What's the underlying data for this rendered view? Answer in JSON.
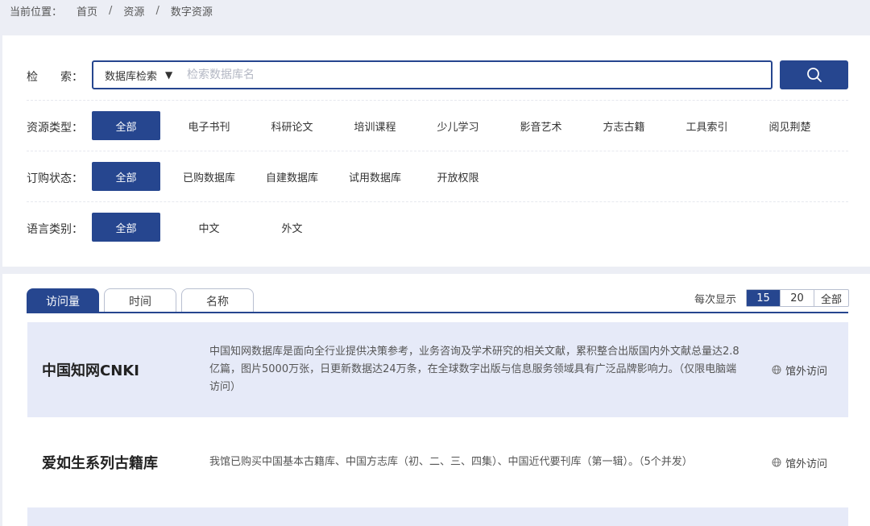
{
  "breadcrumb": {
    "prefix": "当前位置：",
    "items": [
      "首页",
      "资源",
      "数字资源"
    ],
    "sep": "/"
  },
  "search": {
    "label_a": "检",
    "label_b": "索：",
    "scope": "数据库检索",
    "placeholder": "检索数据库名",
    "value": ""
  },
  "filters": {
    "resource_type": {
      "label": "资源类型：",
      "options": [
        "全部",
        "电子书刊",
        "科研论文",
        "培训课程",
        "少儿学习",
        "影音艺术",
        "方志古籍",
        "工具索引",
        "阅见荆楚"
      ]
    },
    "order_status": {
      "label": "订购状态：",
      "options": [
        "全部",
        "已购数据库",
        "自建数据库",
        "试用数据库",
        "开放权限"
      ]
    },
    "language": {
      "label": "语言类别：",
      "options": [
        "全部",
        "中文",
        "外文"
      ]
    }
  },
  "tabs": [
    "访问量",
    "时间",
    "名称"
  ],
  "perpage": {
    "label": "每次显示",
    "options": [
      "15",
      "20",
      "全部"
    ]
  },
  "results": [
    {
      "title": "中国知网CNKI",
      "desc": "中国知网数据库是面向全行业提供决策参考，业务咨询及学术研究的相关文献，累积整合出版国内外文献总量达2.8亿篇，图片5000万张，日更新数据达24万条，在全球数字出版与信息服务领域具有广泛品牌影响力。（仅限电脑端访问）",
      "access": "馆外访问"
    },
    {
      "title": "爱如生系列古籍库",
      "desc": "我馆已购买中国基本古籍库、中国方志库（初、二、三、四集）、中国近代要刊库（第一辑）。（5个并发）",
      "access": "馆外访问"
    }
  ],
  "colors": {
    "primary": "#26468f",
    "row_shade": "#e6eaf8",
    "page_bg": "#eceef5"
  }
}
